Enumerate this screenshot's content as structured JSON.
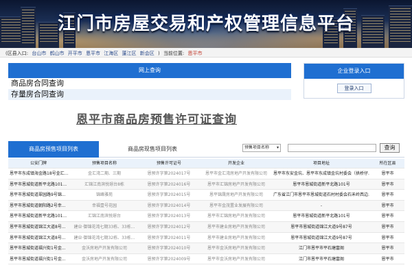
{
  "banner": {
    "title": "江门市房屋交易和产权管理信息平台"
  },
  "region_bar": {
    "label": "(区县入口:",
    "counties": [
      "台山市",
      "鹤山市",
      "开平市",
      "恩平市",
      "江海区",
      "蓬江区",
      "新会区"
    ],
    "close": ")",
    "location_label": "当前位置:",
    "current": "恩平市"
  },
  "online_query": {
    "header": "网上查询",
    "items": [
      "商品房合同查询",
      "存量房合同查询"
    ]
  },
  "enterprise": {
    "header": "企业登录入口",
    "button": "登录入口"
  },
  "page_title": "恩平市商品房预售许可证查询",
  "tabs": {
    "active": "商品房预售项目列表",
    "inactive": "商品房现售项目列表"
  },
  "search": {
    "select_value": "预售项目名称",
    "button": "查询"
  },
  "table": {
    "headers": [
      "公安门牌",
      "预售项目名称",
      "预售许可证号",
      "开发企业",
      "项目地址",
      "所在区县"
    ],
    "rows": [
      [
        "恩平市东成镇海金路18号金汇...",
        "金汇湾二期、三期",
        "恩预许字第2024017号",
        "恩平市金汇湾房地产开发有限公司",
        "恩平市东安金坑、恩平市东成镇金坑村委会（拱桥仔...",
        "恩平市"
      ],
      [
        "恩平市恩城街道新平北路101...",
        "汇锦江南滨悦璟台8栋",
        "恩预许字第2024016号",
        "恩平市汇锦房地产开发有限公司",
        "恩平市恩城街道新平北路101号",
        "恩平市"
      ],
      [
        "恩平市恩城街道翠园路9号锦...",
        "锦峰雅苑",
        "恩预许字第2024015号",
        "恩平锦晟房地产开发有限公司",
        "广东省江门市恩平市恩城街道石村村委会石禾岭西边...",
        "恩平市"
      ],
      [
        "恩平市恩城街道朝阳路2号幸...",
        "幸福壹号花园",
        "恩预许字第2024014号",
        "恩平市金茂置业发展有限公司",
        "-",
        "恩平市"
      ],
      [
        "恩平市恩城街道新平北路101...",
        "汇锦江南滨悦璟台",
        "恩预许字第2024013号",
        "恩平市汇锦房地产开发有限公司",
        "恩平市恩城街道新平北路101号",
        "恩平市"
      ],
      [
        "恩平市恩城街道锦江大道8号...",
        "建业·御锦花湾七期33栋、33栋...",
        "恩预许字第2024012号",
        "恩平市建业房地产开发有限公司",
        "恩平市恩城街道锦江大道9号87号",
        "恩平市"
      ],
      [
        "恩平市恩城街道锦江大道8号...",
        "建业·御锦花湾七期32栋、33栋...",
        "恩预许字第2024011号",
        "恩平市建业房地产开发有限公司",
        "恩平市恩城街道锦江大道9号87号",
        "恩平市"
      ],
      [
        "恩平市恩城街道福兴街1号金...",
        "金沃房地产开发有限公司",
        "恩预许字第2024010号",
        "恩平市金沃房地产开发有限公司",
        "江门市恩平市平石塘富阁",
        "恩平市"
      ],
      [
        "恩平市恩城街道福兴街1号金...",
        "金沃房地产开发有限公司",
        "恩预许字第2024009号",
        "恩平市金沃房地产开发有限公司",
        "江门市恩平市平石塘富阁",
        "恩平市"
      ]
    ]
  }
}
